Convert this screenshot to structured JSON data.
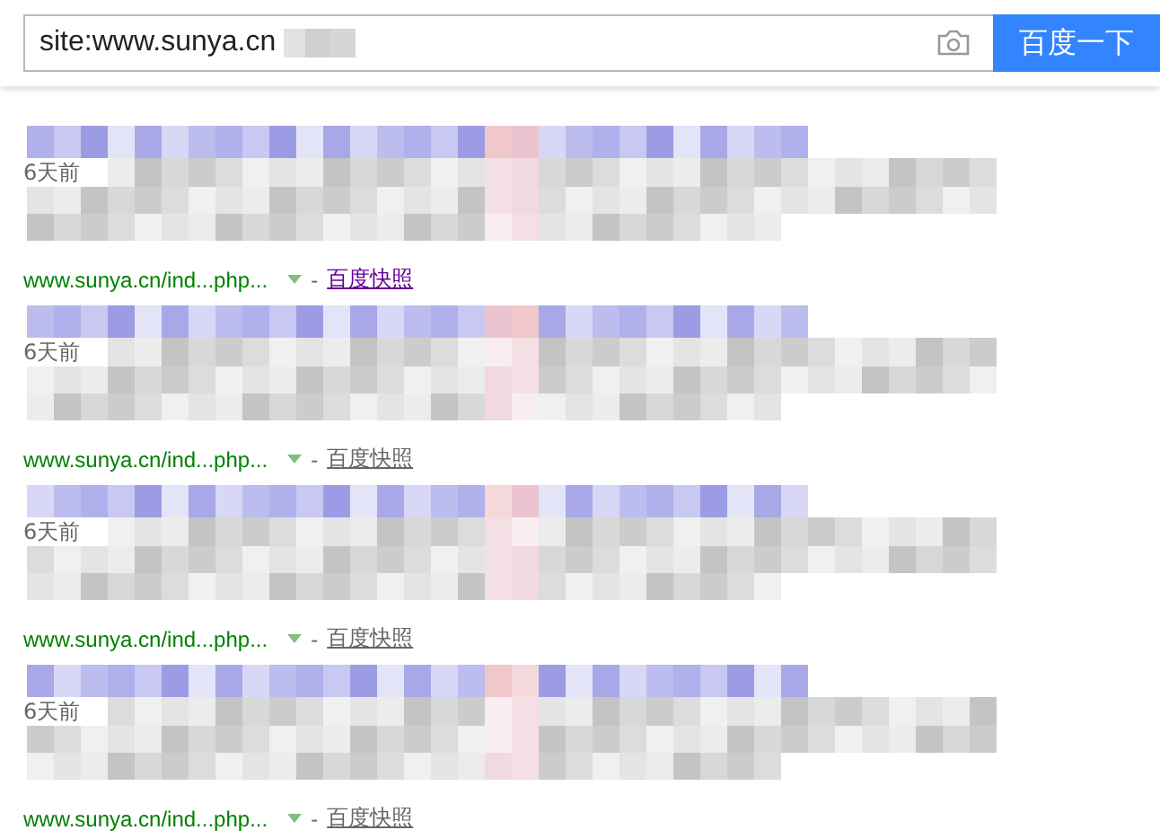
{
  "search": {
    "value": "site:www.sunya.cn",
    "button": "百度一下"
  },
  "results": [
    {
      "date": "6天前",
      "url": "www.sunya.cn/ind...php...",
      "separator": "-",
      "snapshot": {
        "label": "百度快照",
        "visited": true
      }
    },
    {
      "date": "6天前",
      "url": "www.sunya.cn/ind...php...",
      "separator": "-",
      "snapshot": {
        "label": "百度快照",
        "visited": false
      }
    },
    {
      "date": "6天前",
      "url": "www.sunya.cn/ind...php...",
      "separator": "-",
      "snapshot": {
        "label": "百度快照",
        "visited": false
      }
    },
    {
      "date": "6天前",
      "url": "www.sunya.cn/ind...php...",
      "separator": "-",
      "snapshot": {
        "label": "百度快照",
        "visited": false
      }
    }
  ]
}
